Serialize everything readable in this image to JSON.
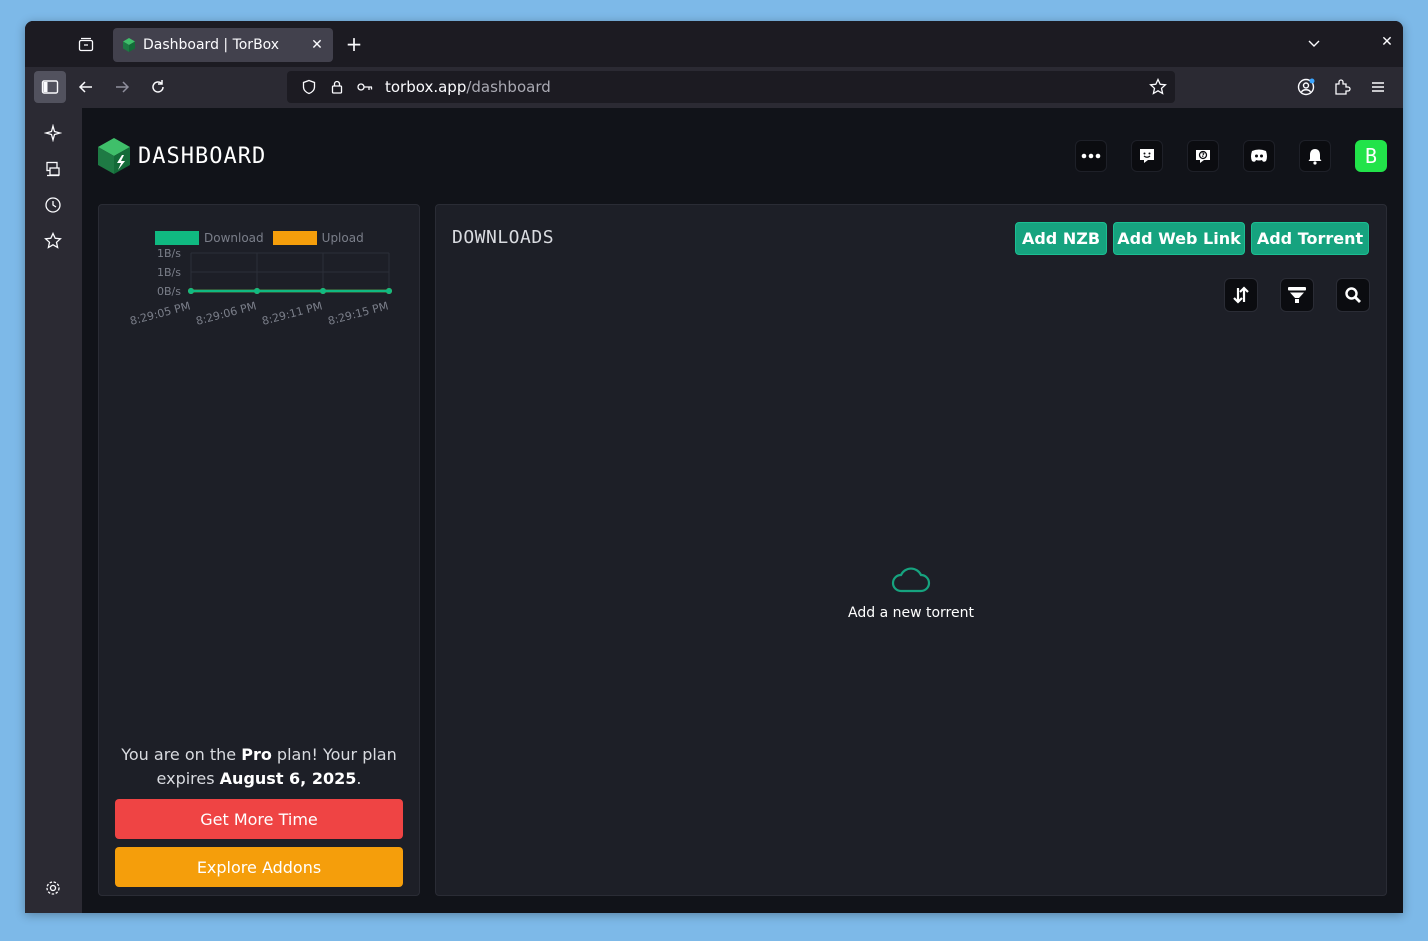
{
  "browser": {
    "tab_title": "Dashboard | TorBox",
    "url_domain": "torbox.app",
    "url_path": "/dashboard"
  },
  "header": {
    "brand": "DASHBOARD",
    "avatar_letter": "B",
    "avatar_color": "#22e34a"
  },
  "speed_chart": {
    "legend": [
      "Download",
      "Upload"
    ],
    "colors": {
      "download": "#10b981",
      "upload": "#f59e0b"
    }
  },
  "chart_data": {
    "type": "line",
    "x": [
      "8:29:05 PM",
      "8:29:06 PM",
      "8:29:11 PM",
      "8:29:15 PM"
    ],
    "y_ticks": [
      "1B/s",
      "1B/s",
      "0B/s"
    ],
    "series": [
      {
        "name": "Download",
        "values": [
          0,
          0,
          0,
          0
        ]
      },
      {
        "name": "Upload",
        "values": [
          0,
          0,
          0,
          0
        ]
      }
    ]
  },
  "plan": {
    "prefix": "You are on the ",
    "plan_name": "Pro",
    "middle": " plan! Your plan expires ",
    "expiry": "August 6, 2025",
    "suffix": ".",
    "get_more_time": "Get More Time",
    "explore_addons": "Explore Addons",
    "red": "#ef4444",
    "orange": "#f59e0b"
  },
  "downloads": {
    "title": "DOWNLOADS",
    "add_nzb": "Add NZB",
    "add_web_link": "Add Web Link",
    "add_torrent": "Add Torrent",
    "empty_text": "Add a new torrent",
    "accent": "#16a37f"
  }
}
